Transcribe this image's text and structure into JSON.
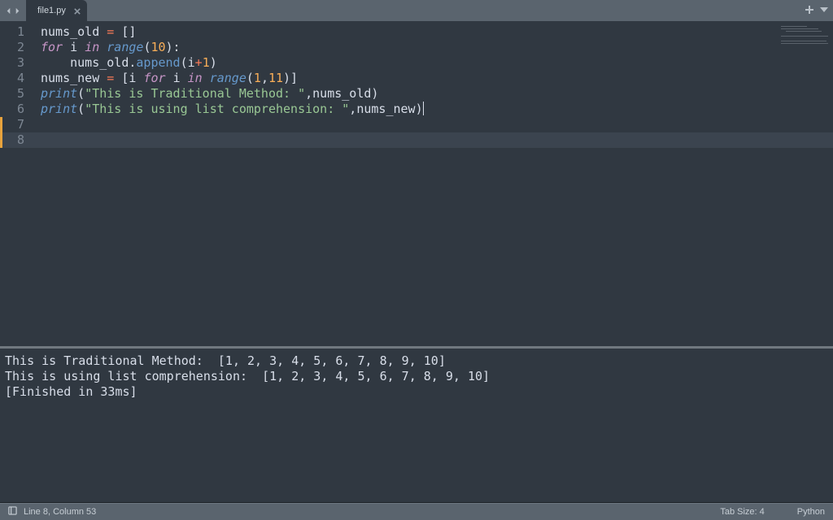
{
  "tab": {
    "filename": "file1.py"
  },
  "code": {
    "lines": [
      {
        "n": 1,
        "tokens": [
          [
            "var",
            "nums_old"
          ],
          [
            "pun",
            " "
          ],
          [
            "op",
            "="
          ],
          [
            "pun",
            " []"
          ]
        ]
      },
      {
        "n": 2,
        "tokens": [
          [
            "kw",
            "for"
          ],
          [
            "pun",
            " "
          ],
          [
            "var",
            "i"
          ],
          [
            "pun",
            " "
          ],
          [
            "kw",
            "in"
          ],
          [
            "pun",
            " "
          ],
          [
            "fn",
            "range"
          ],
          [
            "pun",
            "("
          ],
          [
            "num",
            "10"
          ],
          [
            "pun",
            "):"
          ]
        ]
      },
      {
        "n": 3,
        "tokens": [
          [
            "pun",
            "    "
          ],
          [
            "var",
            "nums_old"
          ],
          [
            "pun",
            "."
          ],
          [
            "call",
            "append"
          ],
          [
            "pun",
            "("
          ],
          [
            "var",
            "i"
          ],
          [
            "op",
            "+"
          ],
          [
            "num",
            "1"
          ],
          [
            "pun",
            ")"
          ]
        ]
      },
      {
        "n": 4,
        "tokens": []
      },
      {
        "n": 5,
        "tokens": [
          [
            "var",
            "nums_new"
          ],
          [
            "pun",
            " "
          ],
          [
            "op",
            "="
          ],
          [
            "pun",
            " ["
          ],
          [
            "var",
            "i"
          ],
          [
            "pun",
            " "
          ],
          [
            "kw",
            "for"
          ],
          [
            "pun",
            " "
          ],
          [
            "var",
            "i"
          ],
          [
            "pun",
            " "
          ],
          [
            "kw",
            "in"
          ],
          [
            "pun",
            " "
          ],
          [
            "fn",
            "range"
          ],
          [
            "pun",
            "("
          ],
          [
            "num",
            "1"
          ],
          [
            "pun",
            ","
          ],
          [
            "num",
            "11"
          ],
          [
            "pun",
            ")]"
          ]
        ]
      },
      {
        "n": 6,
        "tokens": []
      },
      {
        "n": 7,
        "tokens": [
          [
            "fn",
            "print"
          ],
          [
            "pun",
            "("
          ],
          [
            "str",
            "\"This is Traditional Method: \""
          ],
          [
            "pun",
            ","
          ],
          [
            "var",
            "nums_old"
          ],
          [
            "pun",
            ")"
          ]
        ]
      },
      {
        "n": 8,
        "tokens": [
          [
            "fn",
            "print"
          ],
          [
            "pun",
            "("
          ],
          [
            "str",
            "\"This is using list comprehension: \""
          ],
          [
            "pun",
            ","
          ],
          [
            "var",
            "nums_new"
          ],
          [
            "pun",
            ")"
          ]
        ],
        "cursor_after": true
      }
    ],
    "highlight_line": 8,
    "mod_mark_line": 7
  },
  "console": {
    "lines": [
      "This is Traditional Method:  [1, 2, 3, 4, 5, 6, 7, 8, 9, 10]",
      "This is using list comprehension:  [1, 2, 3, 4, 5, 6, 7, 8, 9, 10]",
      "[Finished in 33ms]"
    ]
  },
  "status": {
    "cursor": "Line 8, Column 53",
    "tab_size": "Tab Size: 4",
    "language": "Python"
  }
}
